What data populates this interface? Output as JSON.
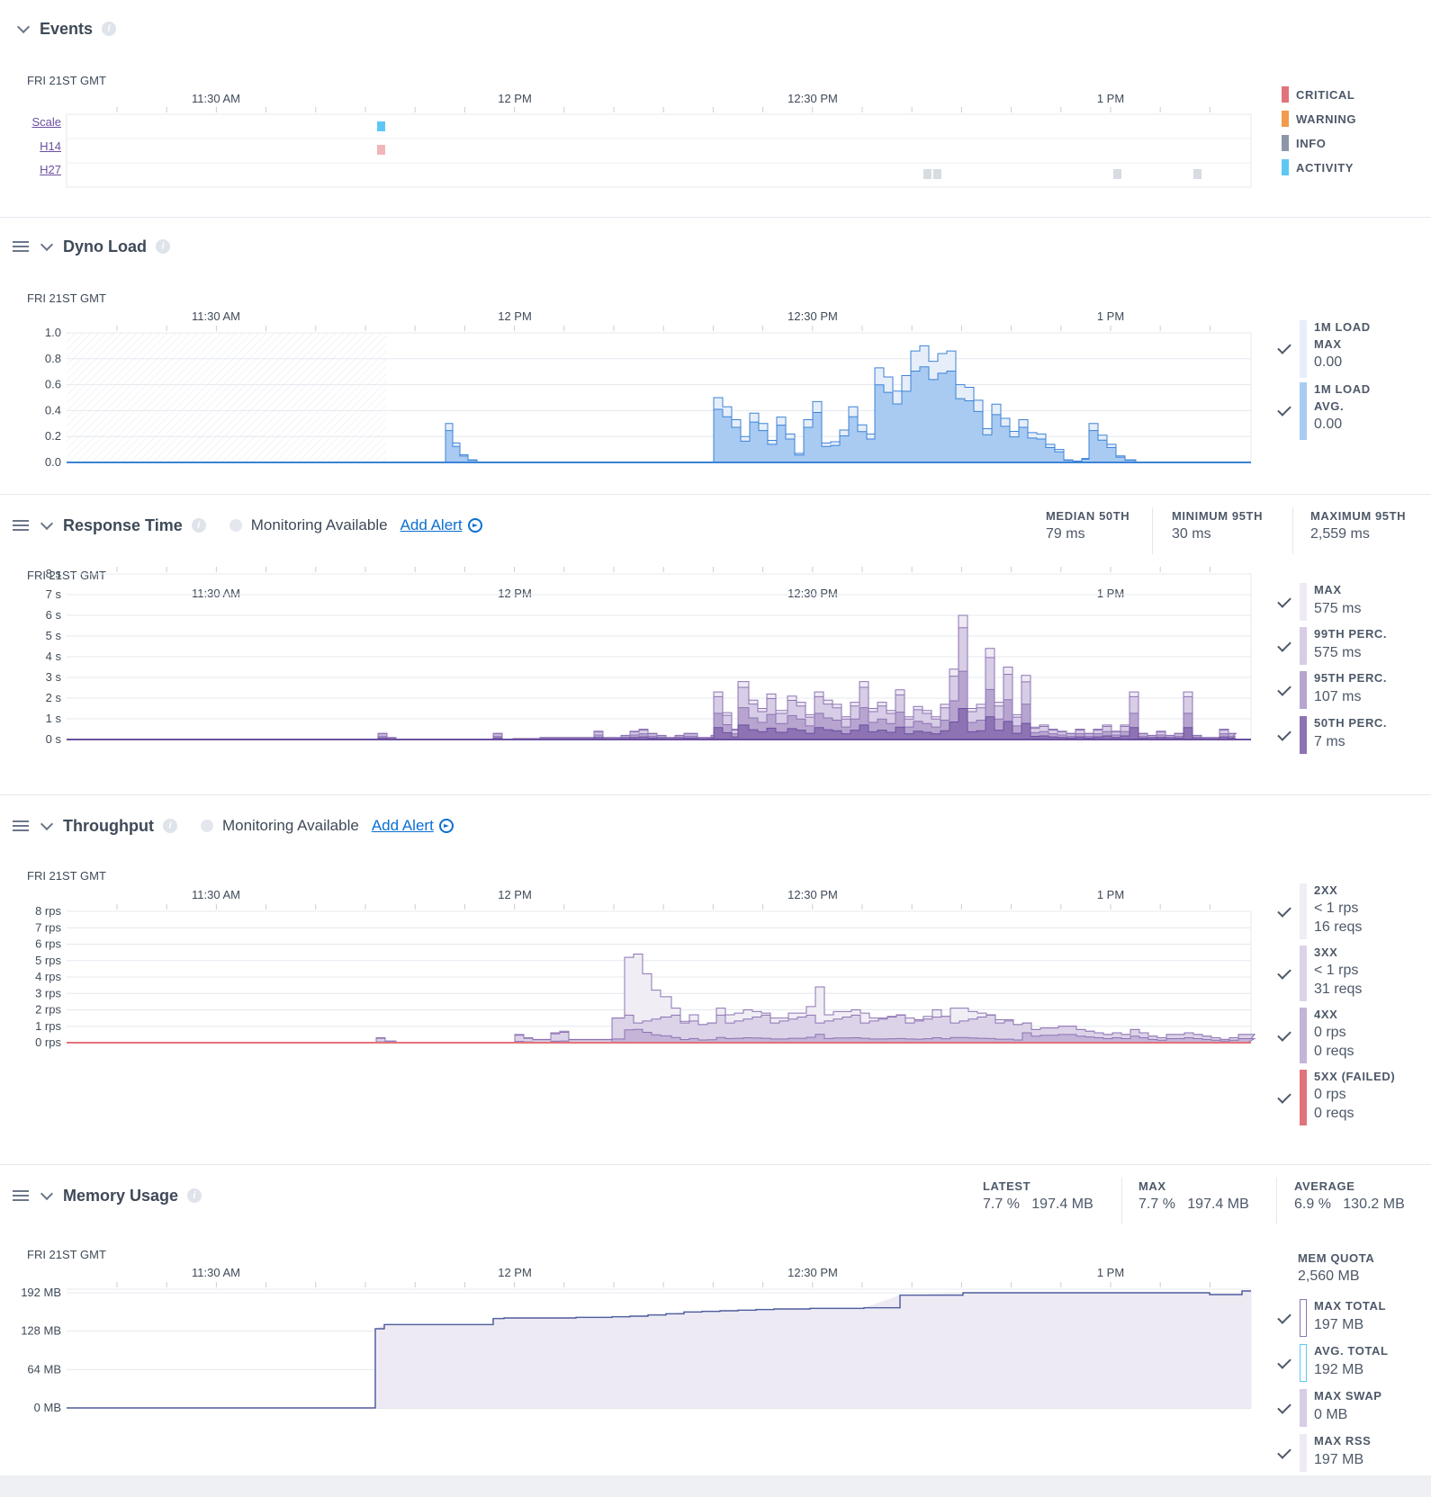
{
  "common": {
    "date": "FRI 21ST GMT",
    "ticks": [
      "11:30 AM",
      "12 PM",
      "12:30 PM",
      "1 PM"
    ]
  },
  "events": {
    "title": "Events",
    "rows": [
      "Scale",
      "H14",
      "H27"
    ],
    "legend": [
      {
        "label": "CRITICAL",
        "color": "#e2737a"
      },
      {
        "label": "WARNING",
        "color": "#f29b4c"
      },
      {
        "label": "INFO",
        "color": "#8d96a8"
      },
      {
        "label": "ACTIVITY",
        "color": "#5ec8f5"
      }
    ]
  },
  "dyno_load": {
    "title": "Dyno Load",
    "yticks": [
      "1.0",
      "0.8",
      "0.6",
      "0.4",
      "0.2",
      "0.0"
    ],
    "legend": [
      {
        "name_1": "1M LOAD",
        "name_2": "MAX",
        "value": "0.00",
        "color": "#e6eef9"
      },
      {
        "name_1": "1M LOAD",
        "name_2": "AVG.",
        "value": "0.00",
        "color": "#a9cbf2"
      }
    ]
  },
  "response_time": {
    "title": "Response Time",
    "monitoring": "Monitoring Available",
    "add_alert": "Add Alert",
    "stats": [
      {
        "name": "MEDIAN 50TH",
        "value": "79 ms"
      },
      {
        "name": "MINIMUM 95TH",
        "value": "30 ms"
      },
      {
        "name": "MAXIMUM 95TH",
        "value": "2,559 ms"
      }
    ],
    "yticks": [
      "8 s",
      "7 s",
      "6 s",
      "5 s",
      "4 s",
      "3 s",
      "2 s",
      "1 s",
      "0 s"
    ],
    "legend": [
      {
        "name": "MAX",
        "value": "575 ms",
        "color": "#eeeaf4"
      },
      {
        "name": "99TH PERC.",
        "value": "575 ms",
        "color": "#d8cde6"
      },
      {
        "name": "95TH PERC.",
        "value": "107 ms",
        "color": "#b7a5d0"
      },
      {
        "name": "50TH PERC.",
        "value": "7 ms",
        "color": "#8d73b3"
      }
    ]
  },
  "throughput": {
    "title": "Throughput",
    "monitoring": "Monitoring Available",
    "add_alert": "Add Alert",
    "yticks": [
      "8 rps",
      "7 rps",
      "6 rps",
      "5 rps",
      "4 rps",
      "3 rps",
      "2 rps",
      "1 rps",
      "0 rps"
    ],
    "legend": [
      {
        "name": "2XX",
        "rate": "< 1 rps",
        "reqs": "16 reqs",
        "color": "#f0edf5"
      },
      {
        "name": "3XX",
        "rate": "< 1 rps",
        "reqs": "31 reqs",
        "color": "#dcd3e8"
      },
      {
        "name": "4XX",
        "rate": "0 rps",
        "reqs": "0 reqs",
        "color": "#c3b4d8"
      },
      {
        "name": "5XX (FAILED)",
        "rate": "0 rps",
        "reqs": "0 reqs",
        "color": "#e2737a"
      }
    ]
  },
  "memory": {
    "title": "Memory Usage",
    "stats": [
      {
        "name": "LATEST",
        "pct": "7.7 %",
        "mb": "197.4 MB"
      },
      {
        "name": "MAX",
        "pct": "7.7 %",
        "mb": "197.4 MB"
      },
      {
        "name": "AVERAGE",
        "pct": "6.9 %",
        "mb": "130.2 MB"
      }
    ],
    "yticks": [
      "192 MB",
      "128 MB",
      "64 MB",
      "0 MB"
    ],
    "quota_label": "MEM QUOTA",
    "quota_value": "2,560 MB",
    "legend": [
      {
        "name": "MAX TOTAL",
        "value": "197 MB",
        "color": "#ffffff",
        "border": "#8d73b3"
      },
      {
        "name": "AVG. TOTAL",
        "value": "192 MB",
        "color": "#ffffff",
        "border": "#5ec8f5"
      },
      {
        "name": "MAX SWAP",
        "value": "0 MB",
        "color": "#d8cde6",
        "border": "#d8cde6"
      },
      {
        "name": "MAX RSS",
        "value": "197 MB",
        "color": "#eeeaf4",
        "border": "#eeeaf4"
      }
    ]
  }
}
